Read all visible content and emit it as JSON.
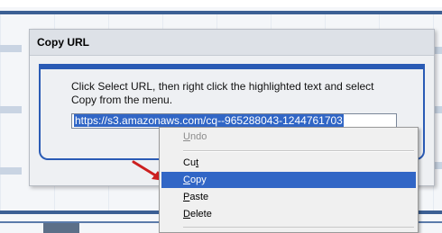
{
  "dialog": {
    "title": "Copy URL",
    "instructions": "Click Select URL, then right click the highlighted text and select Copy from the menu.",
    "url_value": "https://s3.amazonaws.com/cq--965288043-1244761703"
  },
  "context_menu": {
    "items": [
      {
        "pre": "",
        "accel": "U",
        "post": "ndo"
      },
      {
        "pre": "Cu",
        "accel": "t",
        "post": ""
      },
      {
        "pre": "",
        "accel": "C",
        "post": "opy"
      },
      {
        "pre": "",
        "accel": "P",
        "post": "aste"
      },
      {
        "pre": "",
        "accel": "D",
        "post": "elete"
      }
    ]
  },
  "colors": {
    "accent": "#3166c6",
    "dialog_border": "#2a5bb5",
    "arrow": "#cc1f1f"
  },
  "icons": {
    "arrow": "red-pointer-arrow-icon"
  }
}
